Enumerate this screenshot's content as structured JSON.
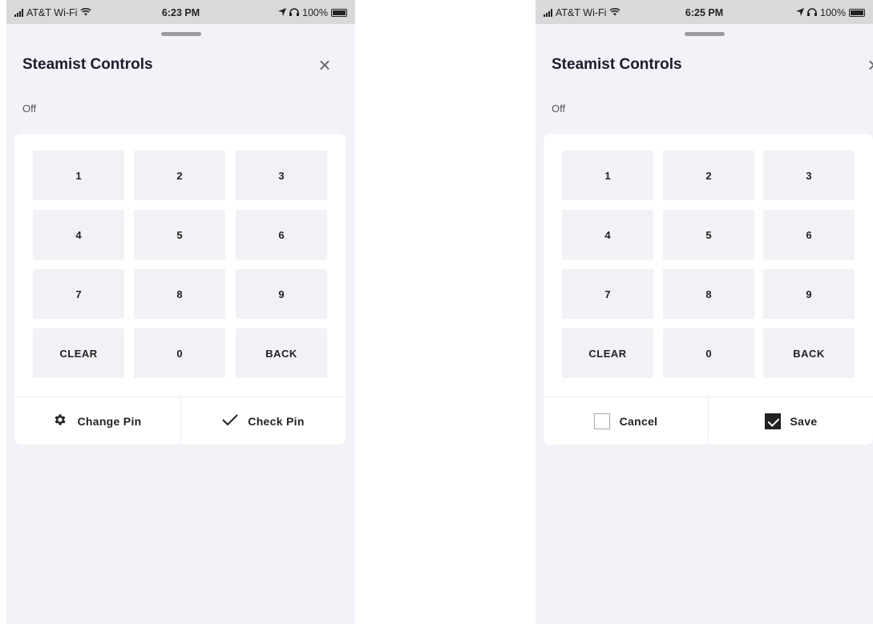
{
  "screens": [
    {
      "status": {
        "carrier": "AT&T Wi-Fi",
        "time": "6:23 PM",
        "battery": "100%"
      },
      "title": "Steamist Controls",
      "state": "Off",
      "keys": [
        "1",
        "2",
        "3",
        "4",
        "5",
        "6",
        "7",
        "8",
        "9",
        "CLEAR",
        "0",
        "BACK"
      ],
      "actions": [
        {
          "label": "Change Pin",
          "icon": "gear-icon"
        },
        {
          "label": "Check Pin",
          "icon": "checkmark-icon"
        }
      ]
    },
    {
      "status": {
        "carrier": "AT&T Wi-Fi",
        "time": "6:25 PM",
        "battery": "100%"
      },
      "title": "Steamist Controls",
      "state": "Off",
      "keys": [
        "1",
        "2",
        "3",
        "4",
        "5",
        "6",
        "7",
        "8",
        "9",
        "CLEAR",
        "0",
        "BACK"
      ],
      "actions": [
        {
          "label": "Cancel",
          "icon": "checkbox-unchecked-icon",
          "checked": false
        },
        {
          "label": "Save",
          "icon": "checkbox-checked-icon",
          "checked": true
        }
      ]
    }
  ]
}
